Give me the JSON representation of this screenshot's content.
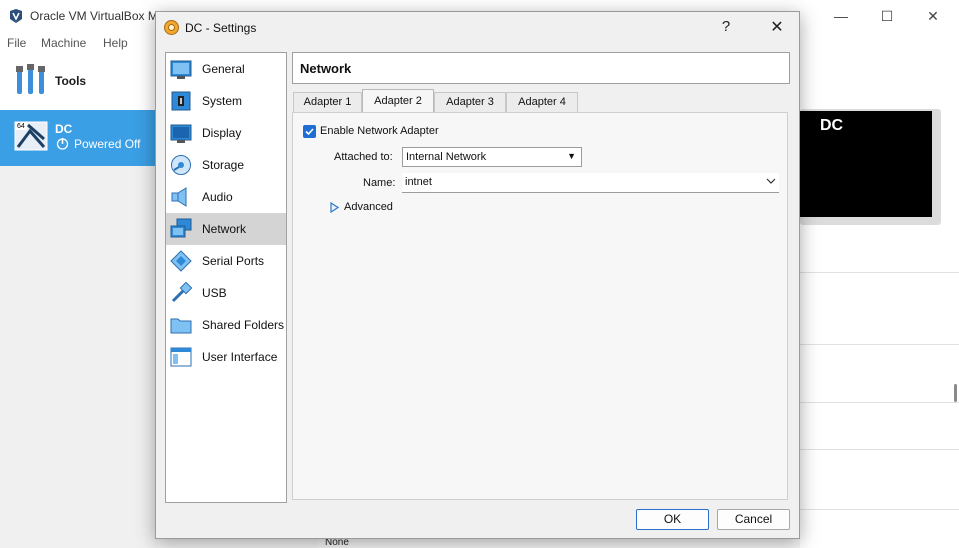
{
  "main_window": {
    "title": "Oracle VM VirtualBox M",
    "menu": [
      "File",
      "Machine",
      "Help"
    ],
    "tools_label": "Tools",
    "vm": {
      "name": "DC",
      "state": "Powered Off",
      "badge": "64"
    },
    "preview_text": "DC",
    "bottom_text": "None"
  },
  "dialog": {
    "title": "DC - Settings",
    "help_label": "?",
    "close_label": "✕",
    "nav_items": [
      {
        "label": "General",
        "icon": "general-icon"
      },
      {
        "label": "System",
        "icon": "system-icon"
      },
      {
        "label": "Display",
        "icon": "display-icon"
      },
      {
        "label": "Storage",
        "icon": "storage-icon"
      },
      {
        "label": "Audio",
        "icon": "audio-icon"
      },
      {
        "label": "Network",
        "icon": "network-icon"
      },
      {
        "label": "Serial Ports",
        "icon": "serial-ports-icon"
      },
      {
        "label": "USB",
        "icon": "usb-icon"
      },
      {
        "label": "Shared Folders",
        "icon": "shared-folders-icon"
      },
      {
        "label": "User Interface",
        "icon": "user-interface-icon"
      }
    ],
    "selected_nav": "Network",
    "section_title": "Network",
    "tabs": [
      "Adapter 1",
      "Adapter 2",
      "Adapter 3",
      "Adapter 4"
    ],
    "active_tab": "Adapter 2",
    "enable_adapter": {
      "label": "Enable Network Adapter",
      "checked": true
    },
    "attached_to": {
      "label": "Attached to:",
      "value": "Internal Network"
    },
    "name": {
      "label": "Name:",
      "value": "intnet"
    },
    "advanced_label": "Advanced",
    "ok_label": "OK",
    "cancel_label": "Cancel"
  },
  "colors": {
    "accent": "#3a9fe4",
    "checkbox": "#1e6fd1",
    "selected_nav_bg": "#d4d4d4"
  }
}
